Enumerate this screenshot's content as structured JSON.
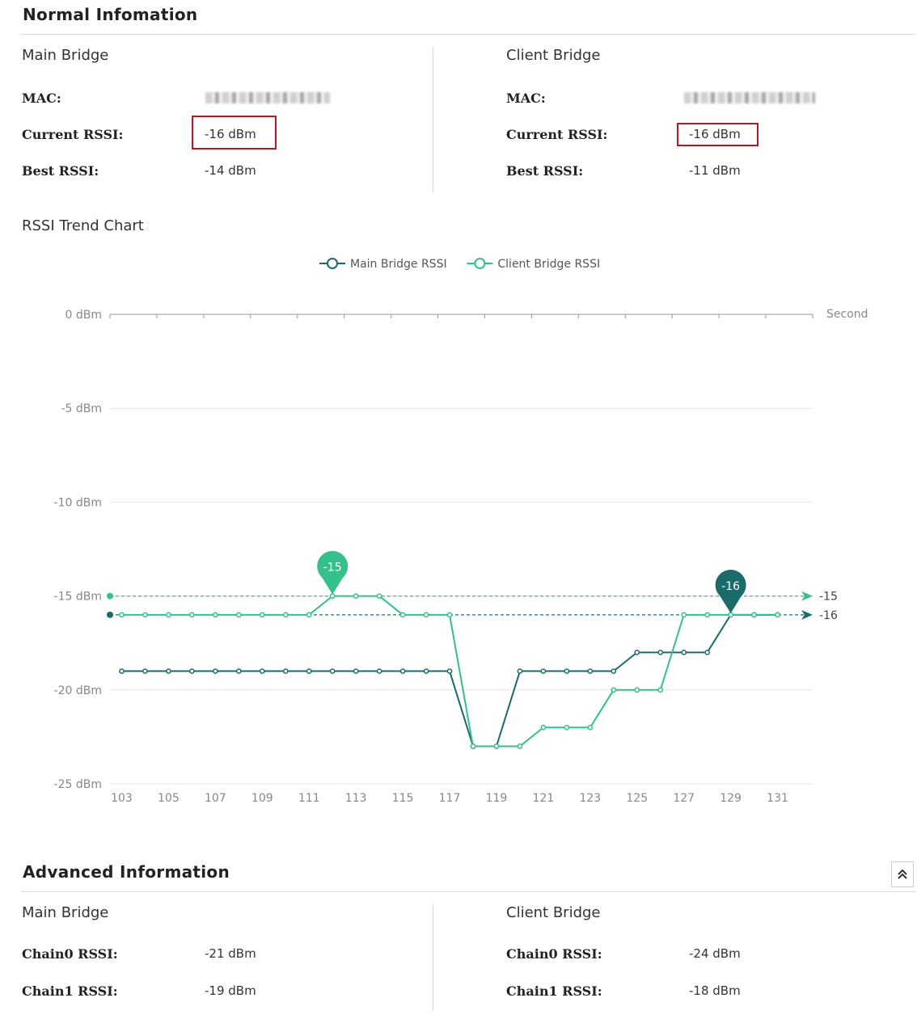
{
  "normal": {
    "title": "Normal Infomation",
    "main": {
      "title": "Main Bridge",
      "mac_label": "MAC:",
      "current_label": "Current RSSI:",
      "current_value": "-16 dBm",
      "best_label": "Best RSSI:",
      "best_value": "-14 dBm"
    },
    "client": {
      "title": "Client Bridge",
      "mac_label": "MAC:",
      "current_label": "Current RSSI:",
      "current_value": "-16 dBm",
      "best_label": "Best RSSI:",
      "best_value": "-11 dBm"
    }
  },
  "trend": {
    "title": "RSSI Trend Chart"
  },
  "chart_data": {
    "type": "line",
    "x": [
      103,
      104,
      105,
      106,
      107,
      108,
      109,
      110,
      111,
      112,
      113,
      114,
      115,
      116,
      117,
      118,
      119,
      120,
      121,
      122,
      123,
      124,
      125,
      126,
      127,
      128,
      129,
      130,
      131
    ],
    "x_ticks": [
      "103",
      "105",
      "107",
      "109",
      "111",
      "113",
      "115",
      "117",
      "119",
      "121",
      "123",
      "125",
      "127",
      "129",
      "131"
    ],
    "y_ticks": [
      "0 dBm",
      "-5 dBm",
      "-10 dBm",
      "-15 dBm",
      "-20 dBm",
      "-25 dBm"
    ],
    "ylim": [
      -25,
      0
    ],
    "xlabel": "Second",
    "legend_position": "top-center",
    "grid": true,
    "series": [
      {
        "name": "Main Bridge RSSI",
        "color": "#1b6b6b",
        "values": [
          -19,
          -19,
          -19,
          -19,
          -19,
          -19,
          -19,
          -19,
          -19,
          -19,
          -19,
          -19,
          -19,
          -19,
          -19,
          -23,
          -23,
          -19,
          -19,
          -19,
          -19,
          -19,
          -18,
          -18,
          -18,
          -18,
          -16,
          -16,
          -16
        ],
        "max_marker": {
          "x": 129,
          "value": -16,
          "label": "-16"
        },
        "avg_line": {
          "value": -16,
          "label": "-16"
        }
      },
      {
        "name": "Client Bridge RSSI",
        "color": "#34c08a",
        "values": [
          -16,
          -16,
          -16,
          -16,
          -16,
          -16,
          -16,
          -16,
          -16,
          -15,
          -15,
          -15,
          -16,
          -16,
          -16,
          -23,
          -23,
          -23,
          -22,
          -22,
          -22,
          -20,
          -20,
          -20,
          -16,
          -16,
          -16,
          -16,
          -16
        ],
        "max_marker": {
          "x": 112,
          "value": -15,
          "label": "-15"
        },
        "avg_line": {
          "value": -15,
          "label": "-15"
        }
      }
    ]
  },
  "advanced": {
    "title": "Advanced Information",
    "collapse_icon": "double-chevron-up-icon",
    "main": {
      "title": "Main Bridge",
      "chain0_label": "Chain0 RSSI:",
      "chain0_value": "-21 dBm",
      "chain1_label": "Chain1 RSSI:",
      "chain1_value": "-19 dBm"
    },
    "client": {
      "title": "Client Bridge",
      "chain0_label": "Chain0 RSSI:",
      "chain0_value": "-24 dBm",
      "chain1_label": "Chain1 RSSI:",
      "chain1_value": "-18 dBm"
    }
  }
}
